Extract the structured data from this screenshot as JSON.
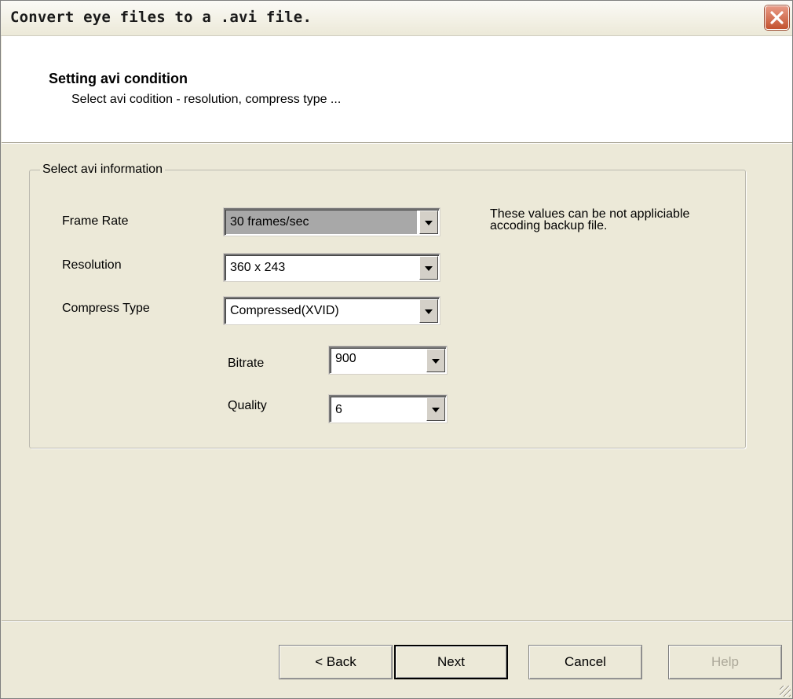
{
  "window": {
    "title": "Convert eye files to a .avi file."
  },
  "header": {
    "title": "Setting avi condition",
    "subtitle": "Select avi codition - resolution, compress type ..."
  },
  "group": {
    "legend": "Select avi information",
    "fields": {
      "frame_rate": {
        "label": "Frame Rate",
        "value": "30 frames/sec"
      },
      "resolution": {
        "label": "Resolution",
        "value": "360 x 243"
      },
      "compress_type": {
        "label": "Compress Type",
        "value": "Compressed(XVID)"
      },
      "bitrate": {
        "label": "Bitrate",
        "value": "900"
      },
      "quality": {
        "label": "Quality",
        "value": "6"
      }
    },
    "note": "These values can be not appliciable accoding backup file."
  },
  "buttons": {
    "back": "< Back",
    "next": "Next",
    "cancel": "Cancel",
    "help": "Help"
  },
  "icons": {
    "close": "close-icon",
    "combo_arrow": "chevron-down-icon",
    "resize": "resize-grip-icon"
  }
}
